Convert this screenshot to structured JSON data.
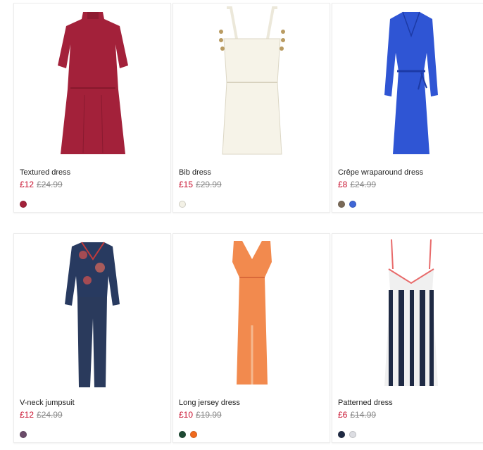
{
  "products": [
    {
      "name": "Textured dress",
      "price": "£12",
      "original_price": "£24.99",
      "swatches": [
        "#a3213a"
      ]
    },
    {
      "name": "Bib dress",
      "price": "£15",
      "original_price": "£29.99",
      "swatches": [
        "#f3f1e6"
      ]
    },
    {
      "name": "Crêpe wraparound dress",
      "price": "£8",
      "original_price": "£24.99",
      "swatches": [
        "#7a6a58",
        "#3f66d6"
      ]
    },
    {
      "name": "V-neck jumpsuit",
      "price": "£12",
      "original_price": "£24.99",
      "swatches": [
        "#6b4c6a"
      ]
    },
    {
      "name": "Long jersey dress",
      "price": "£10",
      "original_price": "£19.99",
      "swatches": [
        "#1e4a33",
        "#f06a1d"
      ]
    },
    {
      "name": "Patterned dress",
      "price": "£6",
      "original_price": "£14.99",
      "swatches": [
        "#1f2a44",
        "#dcdde2"
      ]
    }
  ]
}
